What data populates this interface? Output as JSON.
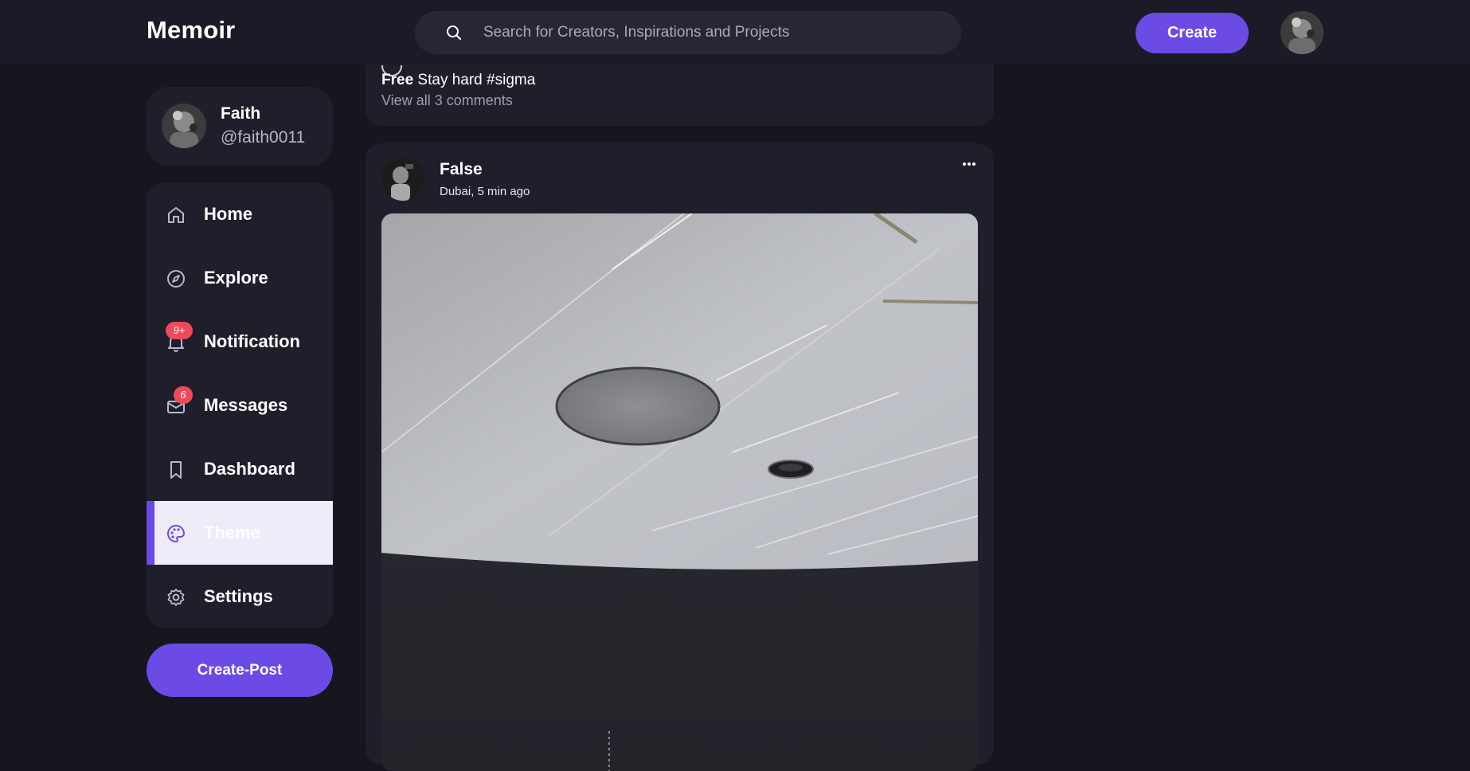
{
  "app": {
    "logo": "Memoir"
  },
  "search": {
    "placeholder": "Search for Creators, Inspirations and Projects"
  },
  "header": {
    "create_label": "Create"
  },
  "profile": {
    "name": "Faith",
    "handle": "@faith0011"
  },
  "nav": {
    "items": [
      {
        "label": "Home",
        "icon": "home-icon"
      },
      {
        "label": "Explore",
        "icon": "compass-icon"
      },
      {
        "label": "Notification",
        "icon": "bell-icon",
        "badge": "9+"
      },
      {
        "label": "Messages",
        "icon": "mail-icon",
        "badge": "6"
      },
      {
        "label": "Dashboard",
        "icon": "bookmark-icon"
      },
      {
        "label": "Theme",
        "icon": "palette-icon",
        "active": true
      },
      {
        "label": "Settings",
        "icon": "gear-icon"
      }
    ]
  },
  "create_post_label": "Create-Post",
  "previous_post": {
    "author": "Free",
    "caption": "Stay hard #sigma",
    "comments_link": "View all 3 comments"
  },
  "post": {
    "author": "False",
    "meta": "Dubai, 5 min ago",
    "more_icon": "more-horizontal-icon"
  },
  "colors": {
    "accent": "#6b4ae6",
    "background": "#16161f",
    "card": "#1f1f2c",
    "badge": "#ef4a5a"
  }
}
